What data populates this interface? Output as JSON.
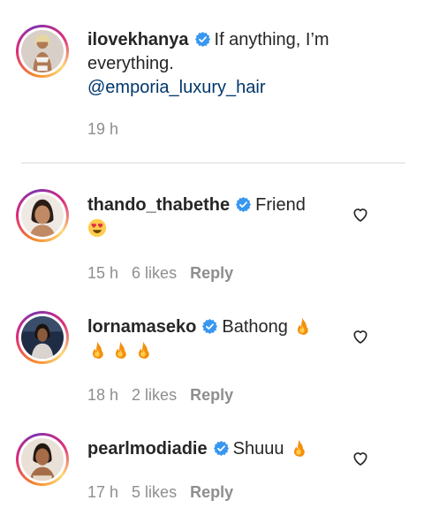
{
  "caption": {
    "username": "ilovekhanya",
    "text": "If anything, I’m everything.",
    "mention": "@emporia_luxury_hair",
    "time": "19 h"
  },
  "comments": [
    {
      "username": "thando_thabethe",
      "text": "Friend",
      "emojis": [
        "heart-eyes"
      ],
      "time": "15 h",
      "likes": "6 likes",
      "reply_label": "Reply"
    },
    {
      "username": "lornamaseko",
      "text": "Bathong",
      "emojis": [
        "fire",
        "fire",
        "fire",
        "fire"
      ],
      "time": "18 h",
      "likes": "2 likes",
      "reply_label": "Reply"
    },
    {
      "username": "pearlmodiadie",
      "text": "Shuuu",
      "emojis": [
        "fire"
      ],
      "time": "17 h",
      "likes": "5 likes",
      "reply_label": "Reply"
    }
  ],
  "icons": {
    "verified": "verified-badge-icon",
    "like": "heart-outline-icon"
  },
  "colors": {
    "verified": "#3897f0",
    "mention": "#00376b",
    "meta": "#8e8e8e",
    "text": "#262626"
  }
}
